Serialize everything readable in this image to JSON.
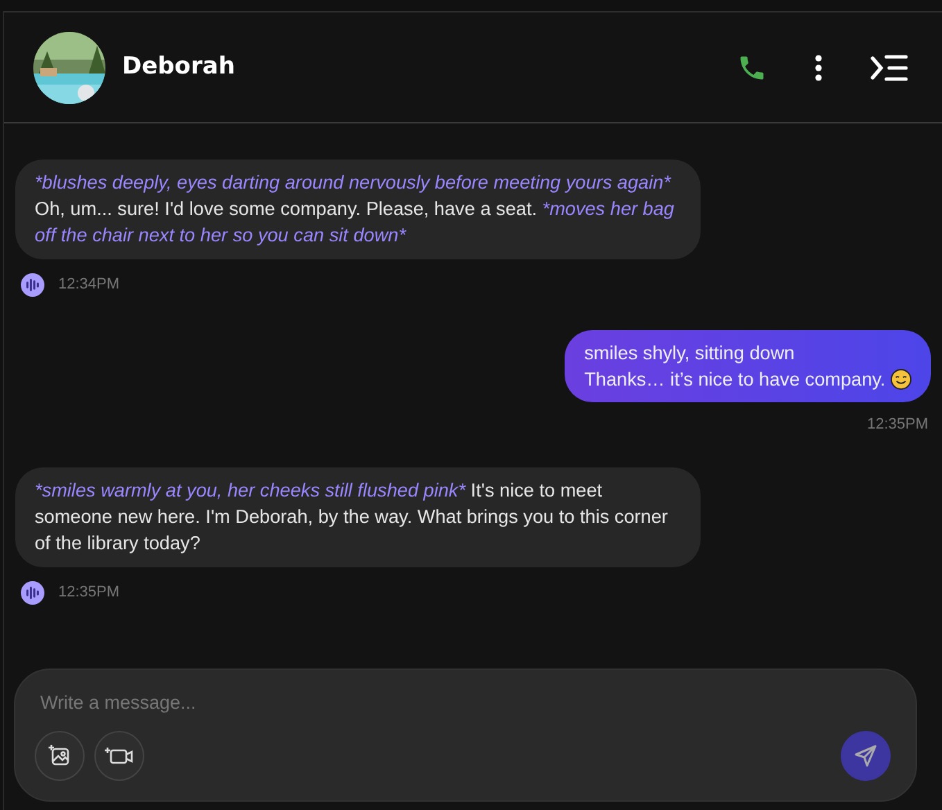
{
  "header": {
    "name": "Deborah"
  },
  "messages": [
    {
      "kind": "bot",
      "lines": [
        [
          {
            "text": "*blushes deeply, eyes darting around nervously before meeting yours again*",
            "action": true
          }
        ],
        [
          {
            "text": "Oh, um... sure! I'd love some company. Please, have a seat.",
            "action": false
          },
          {
            "text": "*moves her bag off the chair next to her so you can sit down*",
            "action": true
          }
        ]
      ],
      "time": "12:34PM"
    },
    {
      "kind": "user",
      "lines": [
        [
          {
            "text": "smiles shyly, sitting down"
          }
        ],
        [
          {
            "text": "Thanks… it’s nice to have company."
          }
        ]
      ],
      "time": "12:35PM"
    },
    {
      "kind": "bot",
      "lines": [
        [
          {
            "text": "*smiles warmly at you, her cheeks still flushed pink*",
            "action": true
          },
          {
            "text": "It's nice to meet someone new here. I'm Deborah, by the way. What brings you to this corner of the library today?",
            "action": false
          }
        ]
      ],
      "time": "12:35PM"
    }
  ],
  "composer": {
    "placeholder": "Write a message..."
  }
}
